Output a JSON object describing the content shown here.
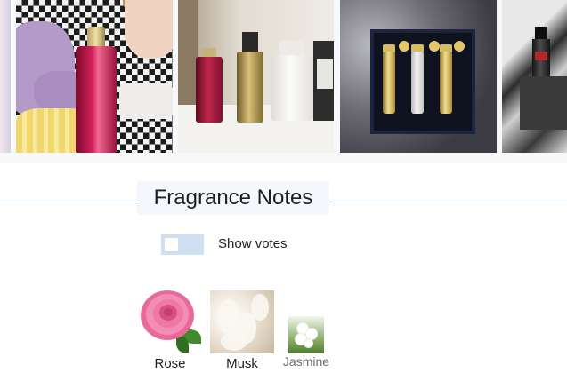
{
  "gallery": {
    "photos": [
      {
        "name": "cropped-photo"
      },
      {
        "name": "child-with-pink-bottle-photo"
      },
      {
        "name": "bottles-on-shelf-photo"
      },
      {
        "name": "gift-box-photo"
      },
      {
        "name": "dark-bottle-photo"
      }
    ]
  },
  "section": {
    "title": "Fragrance Notes"
  },
  "toggle": {
    "label": "Show votes",
    "checked": false
  },
  "notes": [
    {
      "label": "Rose",
      "icon": "rose-image"
    },
    {
      "label": "Musk",
      "icon": "musk-image"
    },
    {
      "label": "Jasmine",
      "icon": "jasmine-image"
    }
  ],
  "colors": {
    "rule": "#6f93b2",
    "heading_bg": "#f4f7fb",
    "toggle_bg": "#cfe0f1",
    "secondary_text": "#6e6e6e"
  }
}
